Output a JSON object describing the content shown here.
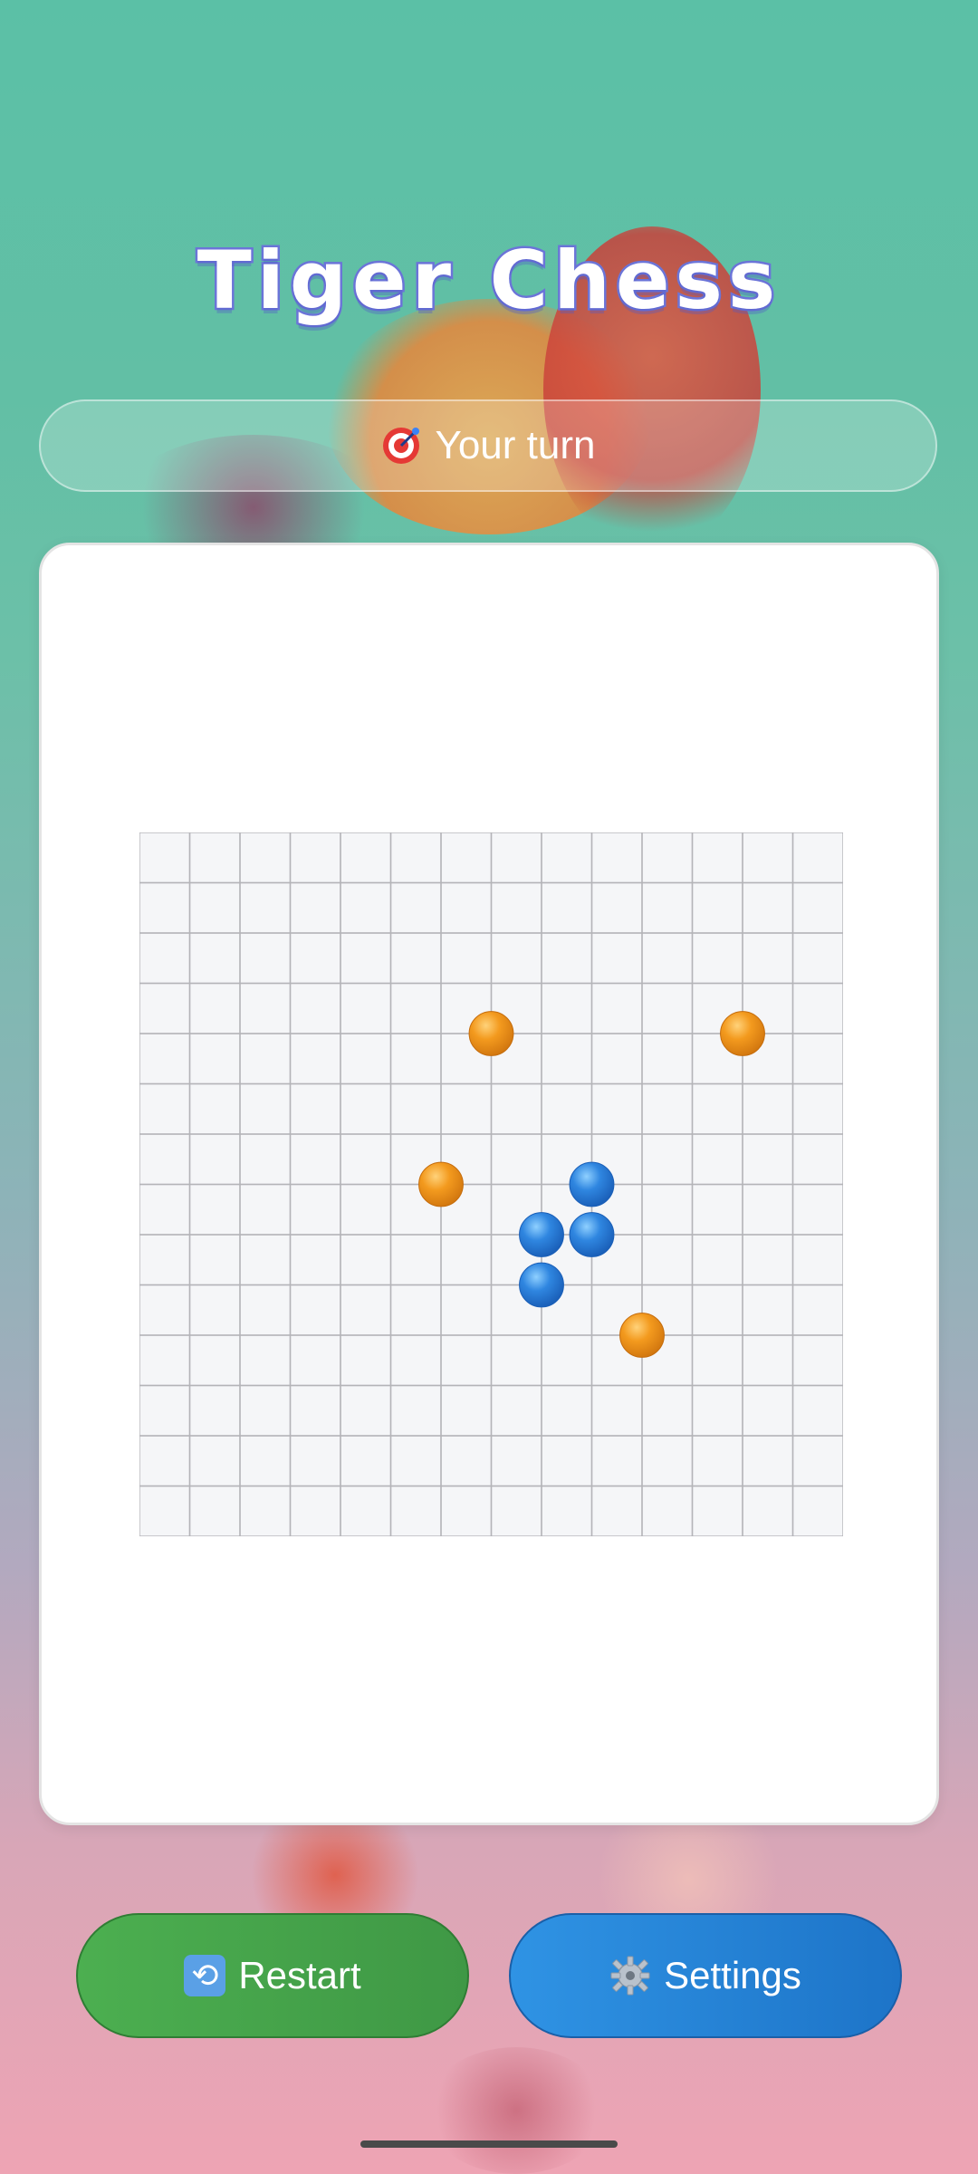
{
  "app": {
    "title": "Tiger Chess"
  },
  "status": {
    "icon": "target-icon",
    "text": "Your turn"
  },
  "board": {
    "columns": 14,
    "rows": 14,
    "grid_line_color": "#b4b4b8",
    "cell_color": "#f5f6f8",
    "pieces": [
      {
        "col": 6,
        "row": 3,
        "color": "orange"
      },
      {
        "col": 11,
        "row": 3,
        "color": "orange"
      },
      {
        "col": 5,
        "row": 6,
        "color": "orange"
      },
      {
        "col": 8,
        "row": 6,
        "color": "blue"
      },
      {
        "col": 7,
        "row": 7,
        "color": "blue"
      },
      {
        "col": 8,
        "row": 7,
        "color": "blue"
      },
      {
        "col": 7,
        "row": 8,
        "color": "blue"
      },
      {
        "col": 9,
        "row": 9,
        "color": "orange"
      }
    ]
  },
  "buttons": {
    "restart": {
      "icon": "restart-icon",
      "label": "Restart"
    },
    "settings": {
      "icon": "gear-icon",
      "label": "Settings"
    }
  },
  "colors": {
    "title_outline": "#6b74d8",
    "restart_green": "#4caf50",
    "settings_blue": "#2f93e4",
    "piece_orange": "#f39a1e",
    "piece_blue": "#2f86e0"
  }
}
